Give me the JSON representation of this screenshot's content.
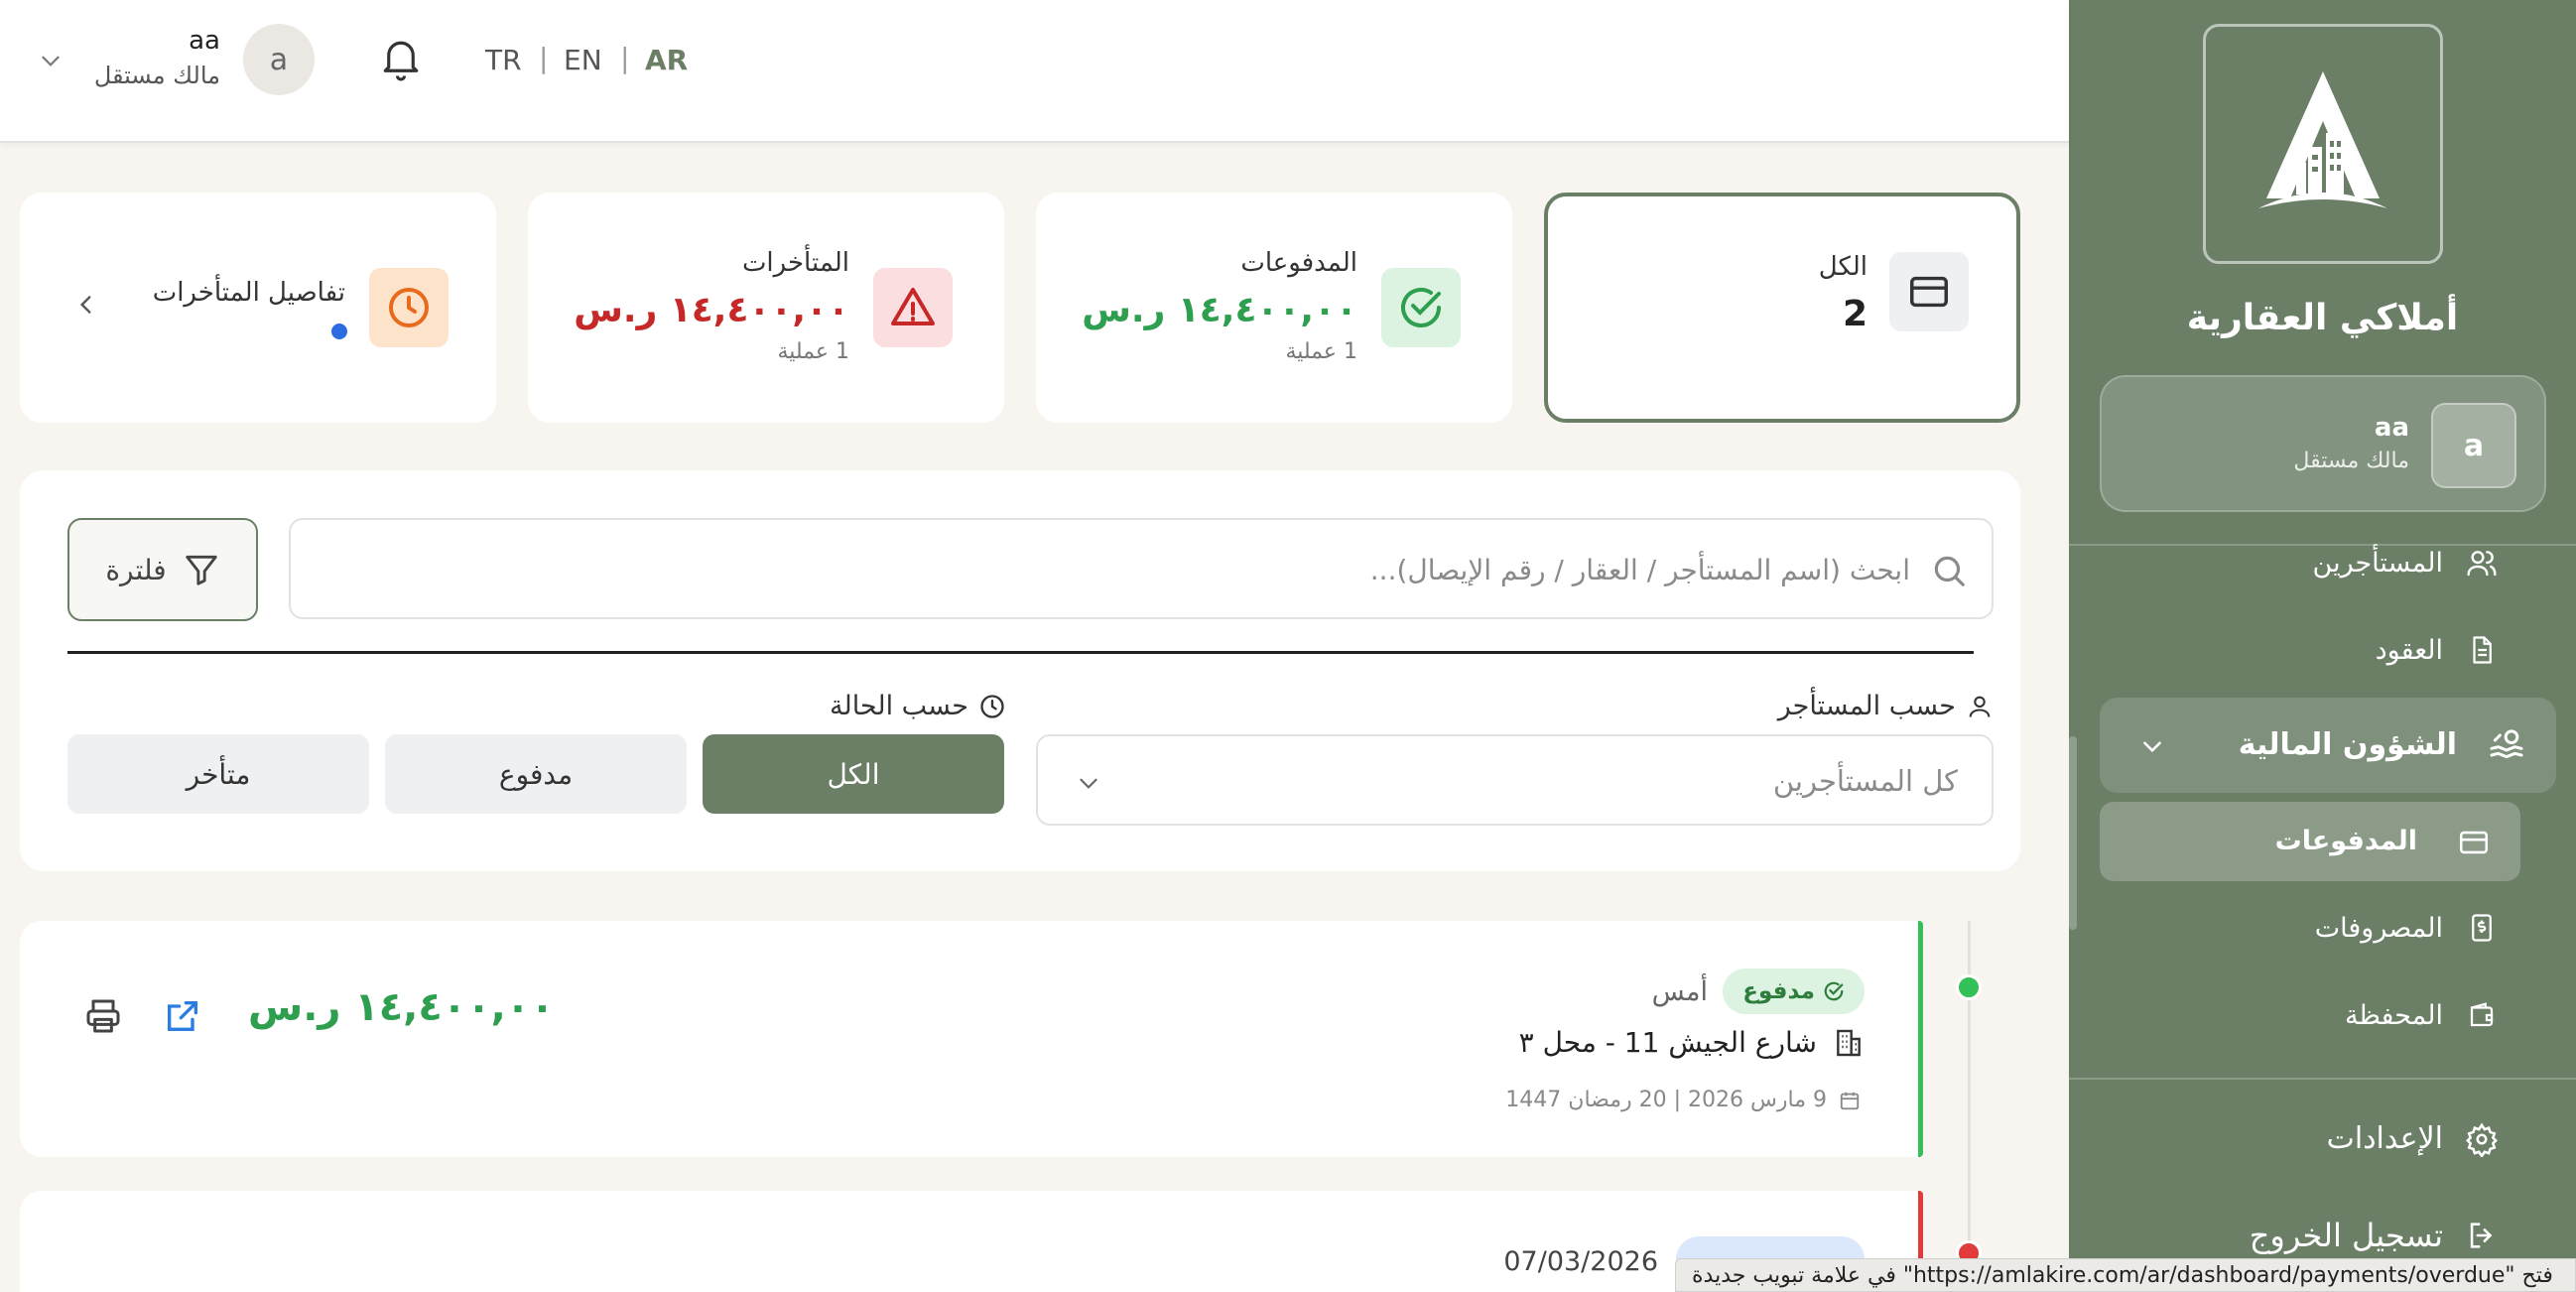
{
  "brand": {
    "name": "أملاكي العقارية"
  },
  "sidebar": {
    "user": {
      "initial": "a",
      "name": "aa",
      "role": "مالك مستقل"
    },
    "items": [
      {
        "label": "المستأجرين",
        "icon": "users-icon"
      },
      {
        "label": "العقود",
        "icon": "document-icon"
      }
    ],
    "group": {
      "label": "الشؤون المالية",
      "icon": "finance-icon",
      "expanded": true
    },
    "sub_items": [
      {
        "label": "المدفوعات",
        "icon": "card-icon",
        "active": true
      },
      {
        "label": "المصروفات",
        "icon": "receipt-icon"
      },
      {
        "label": "المحفظة",
        "icon": "wallet-icon"
      }
    ],
    "settings": "الإعدادات",
    "logout": "تسجيل الخروج"
  },
  "header": {
    "languages": [
      "TR",
      "EN",
      "AR"
    ],
    "active_language": "AR",
    "separator": "|",
    "user": {
      "initial": "a",
      "name": "aa",
      "role": "مالك مستقل"
    }
  },
  "stats": {
    "all": {
      "label": "الكل",
      "value": "2"
    },
    "paid": {
      "label": "المدفوعات",
      "value": "١٤,٤٠٠,٠٠ ر.س",
      "sub": "1 عملية"
    },
    "overdue": {
      "label": "المتأخرات",
      "value": "١٤,٤٠٠,٠٠ ر.س",
      "sub": "1 عملية"
    },
    "overdue_details": {
      "label": "تفاصيل المتأخرات"
    }
  },
  "filters": {
    "search_placeholder": "ابحث (اسم المستأجر / العقار / رقم الإيصال)...",
    "filter_button": "فلترة",
    "by_tenant": "حسب المستأجر",
    "tenant_value": "كل المستأجرين",
    "by_status": "حسب الحالة",
    "status_options": [
      "الكل",
      "مدفوع",
      "متأخر"
    ],
    "status_selected": "الكل"
  },
  "payments": [
    {
      "status": "مدفوع",
      "when": "أمس",
      "address": "شارع الجيش 11 - محل ٣",
      "dates": "9 مارس 2026 | 20 رمضان 1447",
      "amount": "١٤,٤٠٠,٠٠ ر.س"
    },
    {
      "when": "07/03/2026"
    }
  ],
  "statusbar": {
    "text": "فتح \"https://amlakire.com/ar/dashboard/payments/overdue\" في علامة تبويب جديدة"
  },
  "colors": {
    "brand_green": "#6b7f67",
    "paid_green": "#2e9e4f",
    "overdue_red": "#c62828",
    "warning_orange": "#e86a1c",
    "link_blue": "#2b7de1"
  }
}
